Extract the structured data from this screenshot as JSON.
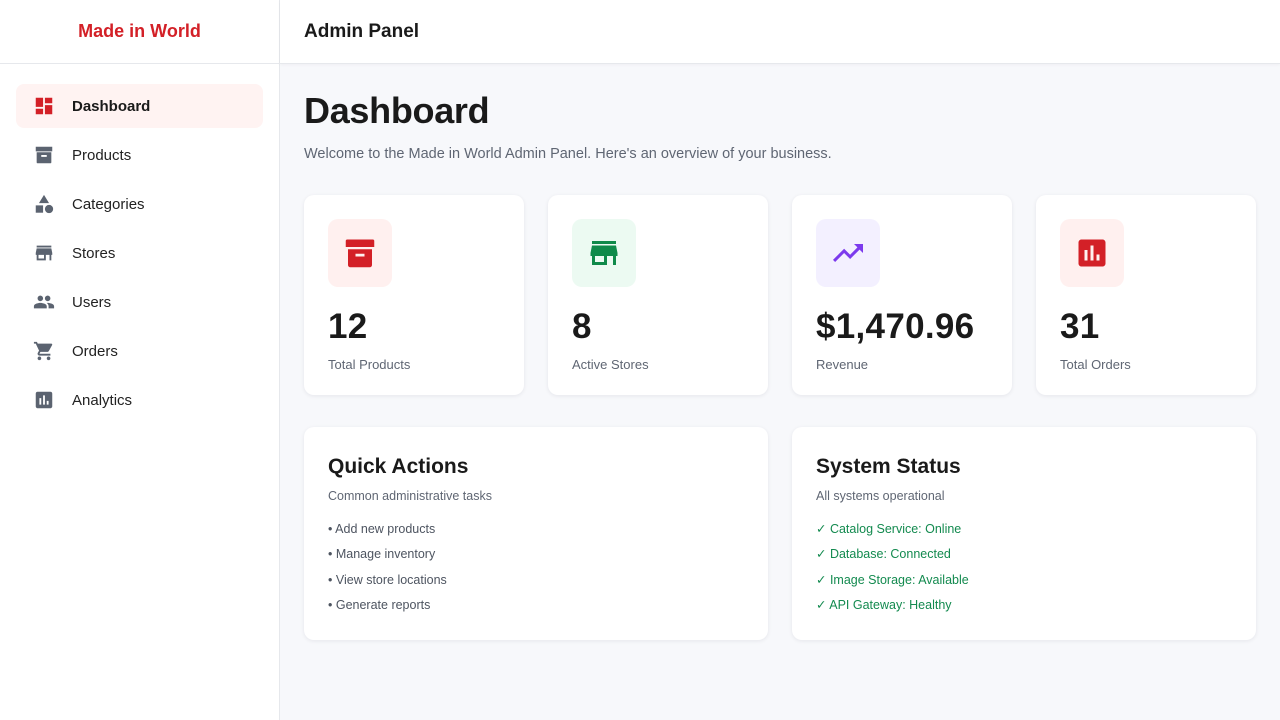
{
  "brand": "Made in World",
  "topbar_title": "Admin Panel",
  "nav": [
    {
      "label": "Dashboard",
      "icon": "dashboard-icon",
      "active": true
    },
    {
      "label": "Products",
      "icon": "archive-icon"
    },
    {
      "label": "Categories",
      "icon": "category-icon"
    },
    {
      "label": "Stores",
      "icon": "store-icon"
    },
    {
      "label": "Users",
      "icon": "users-icon"
    },
    {
      "label": "Orders",
      "icon": "cart-icon"
    },
    {
      "label": "Analytics",
      "icon": "analytics-icon"
    }
  ],
  "page": {
    "title": "Dashboard",
    "subtitle": "Welcome to the Made in World Admin Panel. Here's an overview of your business."
  },
  "stats": [
    {
      "value": "12",
      "label": "Total Products",
      "icon": "archive-icon",
      "color": "#d32027",
      "bg": "#fff0ef"
    },
    {
      "value": "8",
      "label": "Active Stores",
      "icon": "store-icon",
      "color": "#0f8a4a",
      "bg": "#ecfaf2"
    },
    {
      "value": "$1,470.96",
      "label": "Revenue",
      "icon": "trending-up-icon",
      "color": "#7c3aed",
      "bg": "#f3f0ff"
    },
    {
      "value": "31",
      "label": "Total Orders",
      "icon": "analytics-icon",
      "color": "#d32027",
      "bg": "#fff0ef"
    }
  ],
  "quick_actions": {
    "title": "Quick Actions",
    "subtitle": "Common administrative tasks",
    "items": [
      "• Add new products",
      "• Manage inventory",
      "• View store locations",
      "• Generate reports"
    ]
  },
  "system_status": {
    "title": "System Status",
    "subtitle": "All systems operational",
    "items": [
      "✓ Catalog Service: Online",
      "✓ Database: Connected",
      "✓ Image Storage: Available",
      "✓ API Gateway: Healthy"
    ],
    "color": "#138a4f"
  },
  "colors": {
    "brand": "#d32027",
    "nav_icon": "#5b6370",
    "active_bg": "#fff3f2"
  }
}
